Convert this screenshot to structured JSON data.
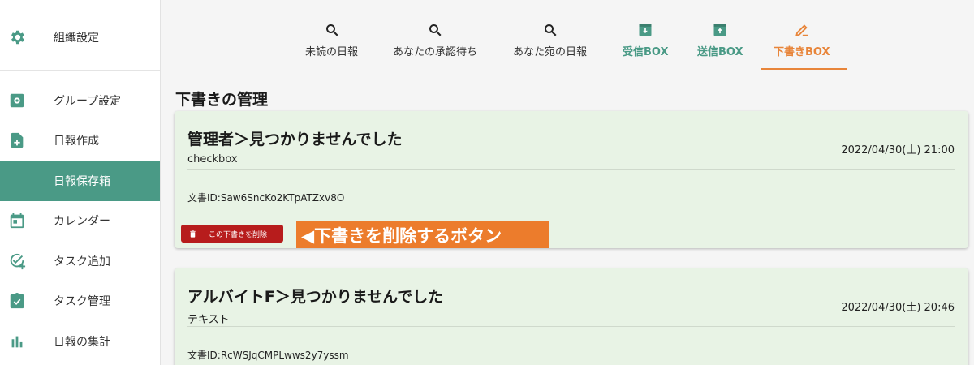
{
  "sidebar": {
    "org": {
      "label": "組織設定",
      "icon": "gear-icon"
    },
    "items": [
      {
        "label": "グループ設定",
        "icon": "group-settings-icon"
      },
      {
        "label": "日報作成",
        "icon": "document-add-icon"
      },
      {
        "label": "日報保存箱",
        "icon": "",
        "active": true
      },
      {
        "label": "カレンダー",
        "icon": "calendar-icon"
      },
      {
        "label": "タスク追加",
        "icon": "task-add-icon"
      },
      {
        "label": "タスク管理",
        "icon": "task-manage-icon"
      },
      {
        "label": "日報の集計",
        "icon": "bar-chart-icon"
      }
    ]
  },
  "tabs": [
    {
      "label": "未読の日報",
      "icon": "search-icon"
    },
    {
      "label": "あなたの承認待ち",
      "icon": "search-icon"
    },
    {
      "label": "あなた宛の日報",
      "icon": "search-icon"
    },
    {
      "label": "受信BOX",
      "icon": "inbox-download-icon"
    },
    {
      "label": "送信BOX",
      "icon": "outbox-upload-icon"
    },
    {
      "label": "下書きBOX",
      "icon": "pencil-icon",
      "active": true
    }
  ],
  "colors": {
    "accent_green": "#4a9a86",
    "accent_orange": "#e8853a",
    "card_bg": "#e8f3e5",
    "delete_red": "#b71c1c"
  },
  "section_title": "下書きの管理",
  "drafts": [
    {
      "title": "管理者＞見つかりませんでした",
      "subtitle": "checkbox",
      "date": "2022/04/30(土) 21:00",
      "doc_id": "文書ID:Saw6SncKo2KTpATZxv8O",
      "delete_label": "この下書きを削除"
    },
    {
      "title": "アルバイトF＞見つかりませんでした",
      "subtitle": "テキスト",
      "date": "2022/04/30(土) 20:46",
      "doc_id": "文書ID:RcWSJqCMPLwws2y7yssm"
    }
  ],
  "annotation": "◀下書きを削除するボタン"
}
